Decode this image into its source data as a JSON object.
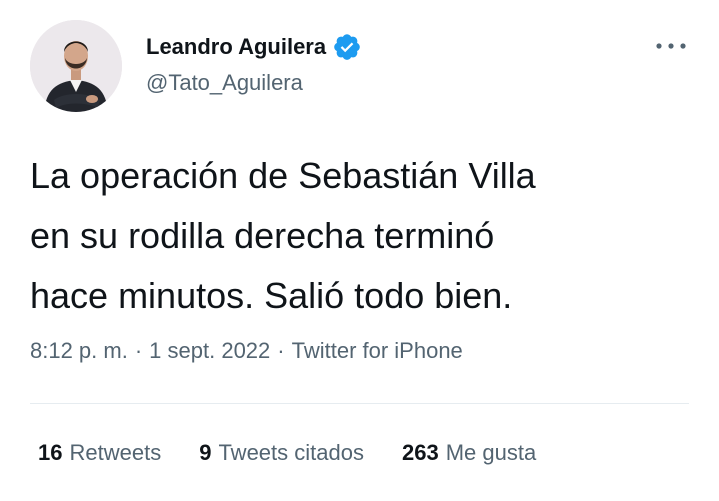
{
  "colors": {
    "text_primary": "#0f1419",
    "text_secondary": "#536471",
    "verified_blue": "#1d9bf0",
    "divider": "#e6ecf0"
  },
  "author": {
    "display_name": "Leandro Aguilera",
    "handle": "@Tato_Aguilera",
    "verified": true,
    "avatar_icon": "profile-photo"
  },
  "tweet": {
    "text_lines": [
      "La operación de Sebastián Villa",
      "en su rodilla derecha terminó",
      "hace minutos. Salió todo bien."
    ],
    "time": "8:12 p. m.",
    "separator": "·",
    "date": "1 sept. 2022",
    "source": "Twitter for iPhone"
  },
  "stats": {
    "retweets": {
      "count": "16",
      "label": "Retweets"
    },
    "quotes": {
      "count": "9",
      "label": "Tweets citados"
    },
    "likes": {
      "count": "263",
      "label": "Me gusta"
    }
  },
  "icons": {
    "more": "more-horizontal-icon",
    "verified": "verified-badge-icon"
  }
}
